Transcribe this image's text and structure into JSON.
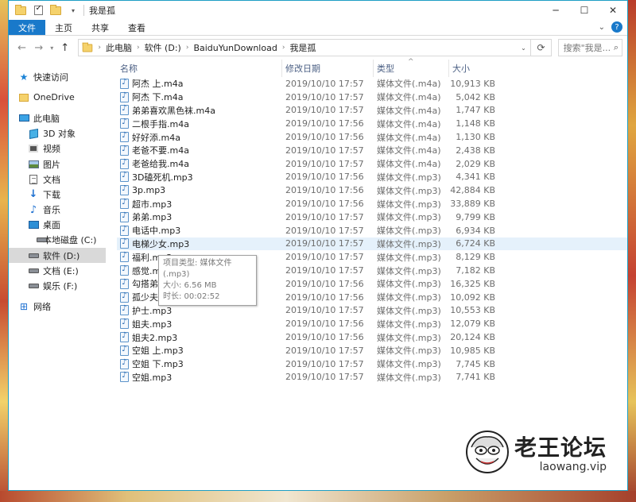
{
  "window": {
    "title": "我是孤",
    "controls": {
      "minimize": "─",
      "maximize": "☐",
      "close": "✕"
    }
  },
  "ribbon": {
    "tabs": [
      "文件",
      "主页",
      "共享",
      "查看"
    ],
    "expand_icon": "chevron-down-icon",
    "help_icon": "?"
  },
  "address": {
    "back": "←",
    "forward": "→",
    "recent": "▾",
    "up": "↑",
    "breadcrumb": [
      "此电脑",
      "软件 (D:)",
      "BaiduYunDownload",
      "我是孤"
    ],
    "search_placeholder": "搜索\"我是..."
  },
  "sidebar": {
    "items": [
      {
        "label": "快速访问",
        "icon": "star-icon"
      },
      {
        "label": "OneDrive",
        "icon": "onedrive-icon"
      },
      {
        "label": "此电脑",
        "icon": "this-pc-icon"
      },
      {
        "label": "3D 对象",
        "icon": "3d-objects-icon"
      },
      {
        "label": "视频",
        "icon": "video-icon"
      },
      {
        "label": "图片",
        "icon": "pictures-icon"
      },
      {
        "label": "文档",
        "icon": "documents-icon"
      },
      {
        "label": "下载",
        "icon": "download-icon"
      },
      {
        "label": "音乐",
        "icon": "music-icon"
      },
      {
        "label": "桌面",
        "icon": "desktop-icon"
      },
      {
        "label": "本地磁盘 (C:)",
        "icon": "drive-c-icon"
      },
      {
        "label": "软件 (D:)",
        "icon": "drive-d-icon"
      },
      {
        "label": "文档 (E:)",
        "icon": "drive-e-icon"
      },
      {
        "label": "娱乐 (F:)",
        "icon": "drive-f-icon"
      },
      {
        "label": "网络",
        "icon": "network-icon"
      }
    ]
  },
  "files": {
    "columns": [
      "名称",
      "修改日期",
      "类型",
      "大小"
    ],
    "rows": [
      {
        "name": "阿杰 上.m4a",
        "date": "2019/10/10 17:57",
        "type": "媒体文件(.m4a)",
        "size": "10,913 KB"
      },
      {
        "name": "阿杰 下.m4a",
        "date": "2019/10/10 17:57",
        "type": "媒体文件(.m4a)",
        "size": "5,042 KB"
      },
      {
        "name": "弟弟喜欢黑色袜.m4a",
        "date": "2019/10/10 17:57",
        "type": "媒体文件(.m4a)",
        "size": "1,747 KB"
      },
      {
        "name": "二根手指.m4a",
        "date": "2019/10/10 17:56",
        "type": "媒体文件(.m4a)",
        "size": "1,148 KB"
      },
      {
        "name": "好好添.m4a",
        "date": "2019/10/10 17:56",
        "type": "媒体文件(.m4a)",
        "size": "1,130 KB"
      },
      {
        "name": "老爸不要.m4a",
        "date": "2019/10/10 17:57",
        "type": "媒体文件(.m4a)",
        "size": "2,438 KB"
      },
      {
        "name": "老爸给我.m4a",
        "date": "2019/10/10 17:57",
        "type": "媒体文件(.m4a)",
        "size": "2,029 KB"
      },
      {
        "name": "3D磕死机.mp3",
        "date": "2019/10/10 17:56",
        "type": "媒体文件(.mp3)",
        "size": "4,341 KB"
      },
      {
        "name": "3p.mp3",
        "date": "2019/10/10 17:56",
        "type": "媒体文件(.mp3)",
        "size": "42,884 KB"
      },
      {
        "name": "超市.mp3",
        "date": "2019/10/10 17:56",
        "type": "媒体文件(.mp3)",
        "size": "33,889 KB"
      },
      {
        "name": "弟弟.mp3",
        "date": "2019/10/10 17:57",
        "type": "媒体文件(.mp3)",
        "size": "9,799 KB"
      },
      {
        "name": "电话中.mp3",
        "date": "2019/10/10 17:57",
        "type": "媒体文件(.mp3)",
        "size": "6,934 KB"
      },
      {
        "name": "电梯少女.mp3",
        "date": "2019/10/10 17:57",
        "type": "媒体文件(.mp3)",
        "size": "6,724 KB"
      },
      {
        "name": "福利.mp3",
        "date": "2019/10/10 17:57",
        "type": "媒体文件(.mp3)",
        "size": "8,129 KB"
      },
      {
        "name": "感觉.mp3",
        "date": "2019/10/10 17:57",
        "type": "媒体文件(.mp3)",
        "size": "7,182 KB"
      },
      {
        "name": "勾搭弟弟.mp3",
        "date": "2019/10/10 17:56",
        "type": "媒体文件(.mp3)",
        "size": "16,325 KB"
      },
      {
        "name": "孤少夫.mp3",
        "date": "2019/10/10 17:56",
        "type": "媒体文件(.mp3)",
        "size": "10,092 KB"
      },
      {
        "name": "护士.mp3",
        "date": "2019/10/10 17:57",
        "type": "媒体文件(.mp3)",
        "size": "10,553 KB"
      },
      {
        "name": "姐夫.mp3",
        "date": "2019/10/10 17:56",
        "type": "媒体文件(.mp3)",
        "size": "12,079 KB"
      },
      {
        "name": "姐夫2.mp3",
        "date": "2019/10/10 17:56",
        "type": "媒体文件(.mp3)",
        "size": "20,124 KB"
      },
      {
        "name": "空姐 上.mp3",
        "date": "2019/10/10 17:57",
        "type": "媒体文件(.mp3)",
        "size": "10,985 KB"
      },
      {
        "name": "空姐 下.mp3",
        "date": "2019/10/10 17:57",
        "type": "媒体文件(.mp3)",
        "size": "7,745 KB"
      },
      {
        "name": "空姐.mp3",
        "date": "2019/10/10 17:57",
        "type": "媒体文件(.mp3)",
        "size": "7,741 KB"
      }
    ]
  },
  "tooltip": {
    "type_line": "项目类型: 媒体文件(.mp3)",
    "size_line": "大小: 6.56 MB",
    "length_line": "时长: 00:02:52"
  },
  "watermark": {
    "title": "老王论坛",
    "url": "laowang.vip"
  },
  "colors": {
    "file_tab": "#1979ca",
    "hover_row": "#e5f1fb",
    "selected_nav": "#d9d9d9",
    "header_text": "#4d6185"
  }
}
